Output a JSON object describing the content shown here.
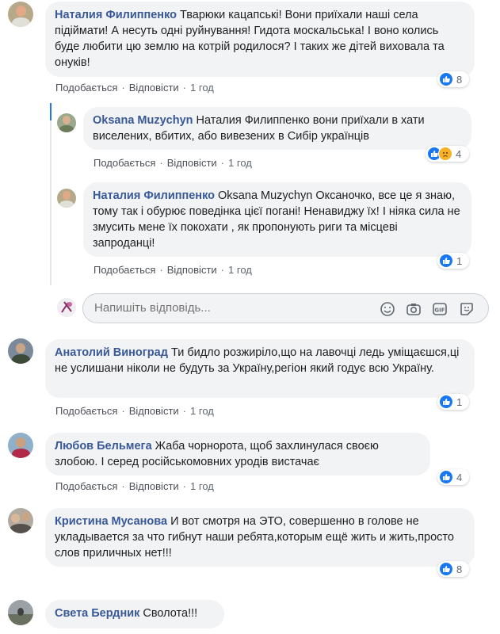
{
  "actions": {
    "like": "Подобається",
    "reply": "Відповісти",
    "sep": "·"
  },
  "reply_box": {
    "placeholder": "Напишіть відповідь..."
  },
  "comments": [
    {
      "author": "Наталия Филиппенко",
      "text": "Тварюки кацапські! Вони приїхали наші села підіймати! А несуть одні руйнування! Гидота москальська! І воно колись буде любити цю землю на котрій родилося? І таких же дітей виховала та онуків!",
      "time": "1 год",
      "reactions": "8"
    },
    {
      "author": "Oksana Muzychyn",
      "text": "Наталия Филиппенко вони приїхали в хати виселених, вбитих, або вивезених в Сибір українців",
      "time": "1 год",
      "reactions": "4"
    },
    {
      "author": "Наталия Филиппенко",
      "text": "Oksana Muzychyn Оксаночко, все це я знаю, тому так і обурює поведінка цієї погані! Ненавиджу їх! І ніяка сила не змусить мене їх покохати , як пропонують риги та місцеві запроданці!",
      "time": "1 год",
      "reactions": "1"
    },
    {
      "author": "Анатолий Виноград",
      "text": "Ти бидло розжиріло,що на лавочці ледь уміщаєшся,ці не услишани ніколи не будуть за Україну,регіон який годує всю Україну.",
      "time": "1 год",
      "reactions": "1"
    },
    {
      "author": "Любов Бельмега",
      "text": "Жаба чорнорота, щоб захлинулася своєю злобою. І серед російськомовних уродів вистачає",
      "time": "1 год",
      "reactions": "4"
    },
    {
      "author": "Кристина Мусанова",
      "text": "И вот смотря на ЭТО, совершенно в голове не укладывается за что гибнут наши ребята,которым ещё жить и жить,просто слов приличных нет!!!",
      "time": "1 год",
      "reactions": "8"
    },
    {
      "author": "Света Бердник",
      "text": "Сволота!!!",
      "time": "",
      "reactions": ""
    }
  ],
  "colors": {
    "author": "#385898",
    "bubble": "#f2f3f5",
    "like": "#1877f2",
    "sad": "#f7b125"
  },
  "icons": [
    "like-icon",
    "sad-icon",
    "emoji-icon",
    "camera-icon",
    "gif-icon",
    "sticker-icon"
  ]
}
